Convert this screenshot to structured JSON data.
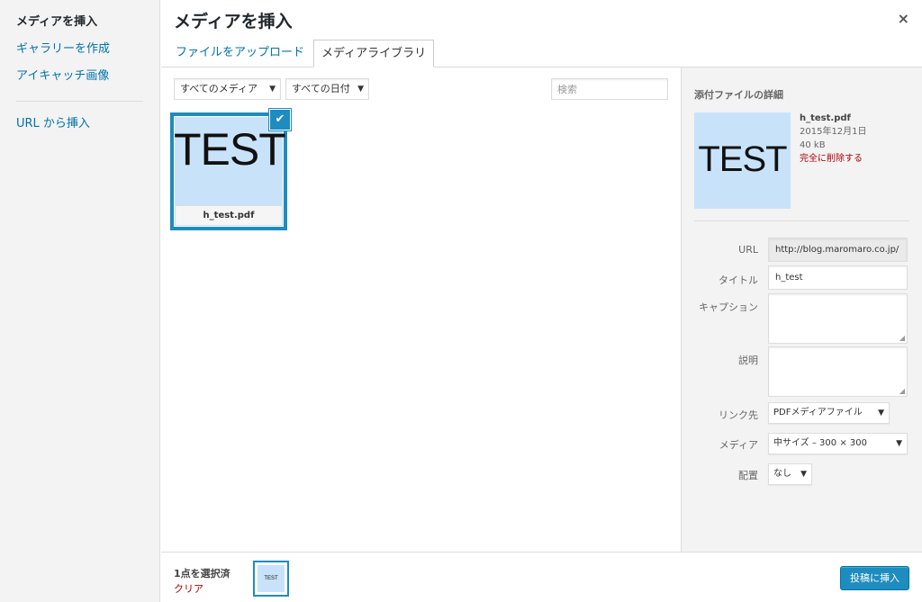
{
  "sidebar": {
    "items": [
      {
        "label": "メディアを挿入"
      },
      {
        "label": "ギャラリーを作成"
      },
      {
        "label": "アイキャッチ画像"
      },
      {
        "label": "URL から挿入"
      }
    ]
  },
  "frame": {
    "title": "メディアを挿入",
    "close_icon": "×"
  },
  "tabs": [
    {
      "label": "ファイルをアップロード"
    },
    {
      "label": "メディアライブラリ"
    }
  ],
  "filters": {
    "media_type": "すべてのメディア",
    "date": "すべての日付",
    "search_placeholder": "検索"
  },
  "attachment": {
    "preview_text": "TEST",
    "filename": "h_test.pdf",
    "check_icon": "✔"
  },
  "details": {
    "heading": "添付ファイルの詳細",
    "preview_text": "TEST",
    "filename": "h_test.pdf",
    "date": "2015年12月1日",
    "size": "40 kB",
    "delete_label": "完全に削除する",
    "url_label": "URL",
    "url_value": "http://blog.maromaro.co.jp/",
    "title_label": "タイトル",
    "title_value": "h_test",
    "caption_label": "キャプション",
    "description_label": "説明",
    "link_label": "リンク先",
    "link_value": "PDFメディアファイル",
    "media_label": "メディア",
    "media_value": "中サイズ – 300 × 300",
    "align_label": "配置",
    "align_value": "なし"
  },
  "bottom": {
    "selected_count": "1点を選択済",
    "clear_label": "クリア",
    "mini_text": "TEST",
    "insert_label": "投稿に挿入"
  },
  "colors": {
    "accent": "#1e8cbe",
    "link": "#0073aa",
    "danger": "#a00",
    "thumb_bg": "#c8e3f9"
  }
}
